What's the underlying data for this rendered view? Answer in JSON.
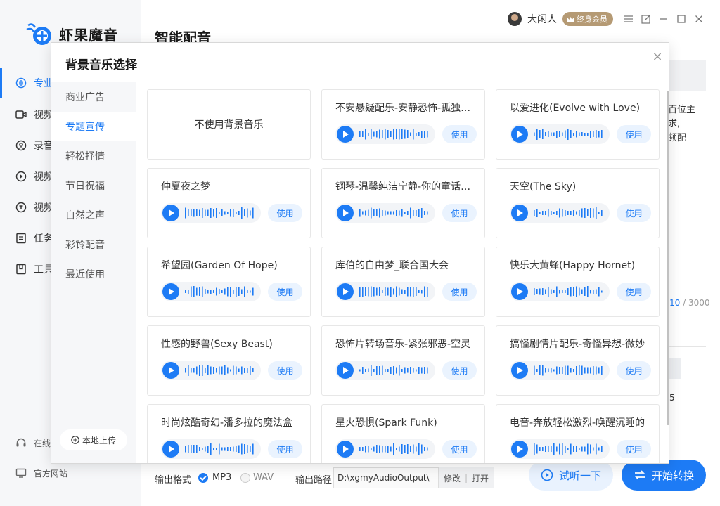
{
  "app": {
    "name": "虾果魔音",
    "page_title": "智能配音"
  },
  "sidebar": {
    "items": [
      {
        "label": "专业",
        "icon": "voice-icon",
        "active": true
      },
      {
        "label": "视频",
        "icon": "video-icon",
        "active": false
      },
      {
        "label": "录音",
        "icon": "record-icon",
        "active": false
      },
      {
        "label": "视频",
        "icon": "video-play-icon",
        "active": false
      },
      {
        "label": "视频",
        "icon": "video-convert-icon",
        "active": false
      },
      {
        "label": "任务",
        "icon": "task-icon",
        "active": false
      },
      {
        "label": "工具",
        "icon": "tools-icon",
        "active": false
      }
    ],
    "footer": [
      {
        "label": "在线",
        "icon": "headset-icon"
      },
      {
        "label": "官方网站",
        "icon": "monitor-icon"
      }
    ]
  },
  "topbar": {
    "user_name": "大闲人",
    "vip_label": "终身会员"
  },
  "background_text": {
    "line1": "百位主",
    "line2": "求,",
    "line3": "频配"
  },
  "char_count": {
    "current": "10",
    "sep": " / ",
    "max": "3000"
  },
  "misc_number": "5",
  "bottom_bar": {
    "format_label": "输出格式",
    "format_options": [
      "MP3",
      "WAV"
    ],
    "format_selected": "MP3",
    "path_label": "输出路径",
    "path_value": "D:\\xgmyAudioOutput\\",
    "modify_label": "修改",
    "divider": "|",
    "open_label": "打开",
    "preview_label": "试听一下",
    "convert_label": "开始转换"
  },
  "modal": {
    "title": "背景音乐选择",
    "close": "×",
    "categories": [
      "商业广告",
      "专题宣传",
      "轻松抒情",
      "节日祝福",
      "自然之声",
      "彩铃配音",
      "最近使用"
    ],
    "active_category": "专题宣传",
    "local_upload": "本地上传",
    "no_music": "不使用背景音乐",
    "use_label": "使用",
    "tracks": [
      "不安悬疑配乐-安静恐怖-孤独寂寞",
      "以爱进化(Evolve with Love)",
      "仲夏夜之梦",
      "钢琴-温馨纯洁宁静-你的童话世界",
      "天空(The Sky)",
      "希望园(Garden Of Hope)",
      "库伯的自由梦_联合国大会",
      "快乐大黄蜂(Happy Hornet)",
      "性感的野兽(Sexy Beast)",
      "恐怖片转场音乐-紧张邪恶-空灵",
      "搞怪剧情片配乐-奇怪异想-微妙",
      "时尚炫酷奇幻-潘多拉的魔法盒",
      "星火恐惧(Spark Funk)",
      "电音-奔放轻松激烈-唤醒沉睡的"
    ]
  },
  "colors": {
    "accent": "#1d7bf5",
    "accent_light": "#eaf3fe",
    "vip": "#b59a74"
  }
}
